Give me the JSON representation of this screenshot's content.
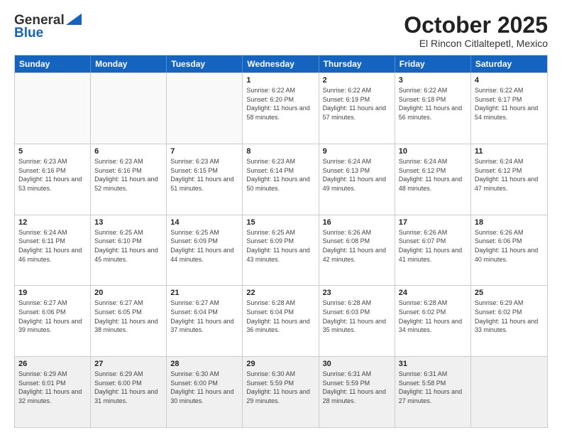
{
  "header": {
    "logo_line1": "General",
    "logo_line2": "Blue",
    "month": "October 2025",
    "location": "El Rincon Citlaltepetl, Mexico"
  },
  "days_of_week": [
    "Sunday",
    "Monday",
    "Tuesday",
    "Wednesday",
    "Thursday",
    "Friday",
    "Saturday"
  ],
  "weeks": [
    [
      {
        "day": "",
        "sunrise": "",
        "sunset": "",
        "daylight": "",
        "empty": true
      },
      {
        "day": "",
        "sunrise": "",
        "sunset": "",
        "daylight": "",
        "empty": true
      },
      {
        "day": "",
        "sunrise": "",
        "sunset": "",
        "daylight": "",
        "empty": true
      },
      {
        "day": "1",
        "sunrise": "Sunrise: 6:22 AM",
        "sunset": "Sunset: 6:20 PM",
        "daylight": "Daylight: 11 hours and 58 minutes.",
        "empty": false
      },
      {
        "day": "2",
        "sunrise": "Sunrise: 6:22 AM",
        "sunset": "Sunset: 6:19 PM",
        "daylight": "Daylight: 11 hours and 57 minutes.",
        "empty": false
      },
      {
        "day": "3",
        "sunrise": "Sunrise: 6:22 AM",
        "sunset": "Sunset: 6:18 PM",
        "daylight": "Daylight: 11 hours and 56 minutes.",
        "empty": false
      },
      {
        "day": "4",
        "sunrise": "Sunrise: 6:22 AM",
        "sunset": "Sunset: 6:17 PM",
        "daylight": "Daylight: 11 hours and 54 minutes.",
        "empty": false
      }
    ],
    [
      {
        "day": "5",
        "sunrise": "Sunrise: 6:23 AM",
        "sunset": "Sunset: 6:16 PM",
        "daylight": "Daylight: 11 hours and 53 minutes.",
        "empty": false
      },
      {
        "day": "6",
        "sunrise": "Sunrise: 6:23 AM",
        "sunset": "Sunset: 6:16 PM",
        "daylight": "Daylight: 11 hours and 52 minutes.",
        "empty": false
      },
      {
        "day": "7",
        "sunrise": "Sunrise: 6:23 AM",
        "sunset": "Sunset: 6:15 PM",
        "daylight": "Daylight: 11 hours and 51 minutes.",
        "empty": false
      },
      {
        "day": "8",
        "sunrise": "Sunrise: 6:23 AM",
        "sunset": "Sunset: 6:14 PM",
        "daylight": "Daylight: 11 hours and 50 minutes.",
        "empty": false
      },
      {
        "day": "9",
        "sunrise": "Sunrise: 6:24 AM",
        "sunset": "Sunset: 6:13 PM",
        "daylight": "Daylight: 11 hours and 49 minutes.",
        "empty": false
      },
      {
        "day": "10",
        "sunrise": "Sunrise: 6:24 AM",
        "sunset": "Sunset: 6:12 PM",
        "daylight": "Daylight: 11 hours and 48 minutes.",
        "empty": false
      },
      {
        "day": "11",
        "sunrise": "Sunrise: 6:24 AM",
        "sunset": "Sunset: 6:12 PM",
        "daylight": "Daylight: 11 hours and 47 minutes.",
        "empty": false
      }
    ],
    [
      {
        "day": "12",
        "sunrise": "Sunrise: 6:24 AM",
        "sunset": "Sunset: 6:11 PM",
        "daylight": "Daylight: 11 hours and 46 minutes.",
        "empty": false
      },
      {
        "day": "13",
        "sunrise": "Sunrise: 6:25 AM",
        "sunset": "Sunset: 6:10 PM",
        "daylight": "Daylight: 11 hours and 45 minutes.",
        "empty": false
      },
      {
        "day": "14",
        "sunrise": "Sunrise: 6:25 AM",
        "sunset": "Sunset: 6:09 PM",
        "daylight": "Daylight: 11 hours and 44 minutes.",
        "empty": false
      },
      {
        "day": "15",
        "sunrise": "Sunrise: 6:25 AM",
        "sunset": "Sunset: 6:09 PM",
        "daylight": "Daylight: 11 hours and 43 minutes.",
        "empty": false
      },
      {
        "day": "16",
        "sunrise": "Sunrise: 6:26 AM",
        "sunset": "Sunset: 6:08 PM",
        "daylight": "Daylight: 11 hours and 42 minutes.",
        "empty": false
      },
      {
        "day": "17",
        "sunrise": "Sunrise: 6:26 AM",
        "sunset": "Sunset: 6:07 PM",
        "daylight": "Daylight: 11 hours and 41 minutes.",
        "empty": false
      },
      {
        "day": "18",
        "sunrise": "Sunrise: 6:26 AM",
        "sunset": "Sunset: 6:06 PM",
        "daylight": "Daylight: 11 hours and 40 minutes.",
        "empty": false
      }
    ],
    [
      {
        "day": "19",
        "sunrise": "Sunrise: 6:27 AM",
        "sunset": "Sunset: 6:06 PM",
        "daylight": "Daylight: 11 hours and 39 minutes.",
        "empty": false
      },
      {
        "day": "20",
        "sunrise": "Sunrise: 6:27 AM",
        "sunset": "Sunset: 6:05 PM",
        "daylight": "Daylight: 11 hours and 38 minutes.",
        "empty": false
      },
      {
        "day": "21",
        "sunrise": "Sunrise: 6:27 AM",
        "sunset": "Sunset: 6:04 PM",
        "daylight": "Daylight: 11 hours and 37 minutes.",
        "empty": false
      },
      {
        "day": "22",
        "sunrise": "Sunrise: 6:28 AM",
        "sunset": "Sunset: 6:04 PM",
        "daylight": "Daylight: 11 hours and 36 minutes.",
        "empty": false
      },
      {
        "day": "23",
        "sunrise": "Sunrise: 6:28 AM",
        "sunset": "Sunset: 6:03 PM",
        "daylight": "Daylight: 11 hours and 35 minutes.",
        "empty": false
      },
      {
        "day": "24",
        "sunrise": "Sunrise: 6:28 AM",
        "sunset": "Sunset: 6:02 PM",
        "daylight": "Daylight: 11 hours and 34 minutes.",
        "empty": false
      },
      {
        "day": "25",
        "sunrise": "Sunrise: 6:29 AM",
        "sunset": "Sunset: 6:02 PM",
        "daylight": "Daylight: 11 hours and 33 minutes.",
        "empty": false
      }
    ],
    [
      {
        "day": "26",
        "sunrise": "Sunrise: 6:29 AM",
        "sunset": "Sunset: 6:01 PM",
        "daylight": "Daylight: 11 hours and 32 minutes.",
        "empty": false
      },
      {
        "day": "27",
        "sunrise": "Sunrise: 6:29 AM",
        "sunset": "Sunset: 6:00 PM",
        "daylight": "Daylight: 11 hours and 31 minutes.",
        "empty": false
      },
      {
        "day": "28",
        "sunrise": "Sunrise: 6:30 AM",
        "sunset": "Sunset: 6:00 PM",
        "daylight": "Daylight: 11 hours and 30 minutes.",
        "empty": false
      },
      {
        "day": "29",
        "sunrise": "Sunrise: 6:30 AM",
        "sunset": "Sunset: 5:59 PM",
        "daylight": "Daylight: 11 hours and 29 minutes.",
        "empty": false
      },
      {
        "day": "30",
        "sunrise": "Sunrise: 6:31 AM",
        "sunset": "Sunset: 5:59 PM",
        "daylight": "Daylight: 11 hours and 28 minutes.",
        "empty": false
      },
      {
        "day": "31",
        "sunrise": "Sunrise: 6:31 AM",
        "sunset": "Sunset: 5:58 PM",
        "daylight": "Daylight: 11 hours and 27 minutes.",
        "empty": false
      },
      {
        "day": "",
        "sunrise": "",
        "sunset": "",
        "daylight": "",
        "empty": true
      }
    ]
  ]
}
